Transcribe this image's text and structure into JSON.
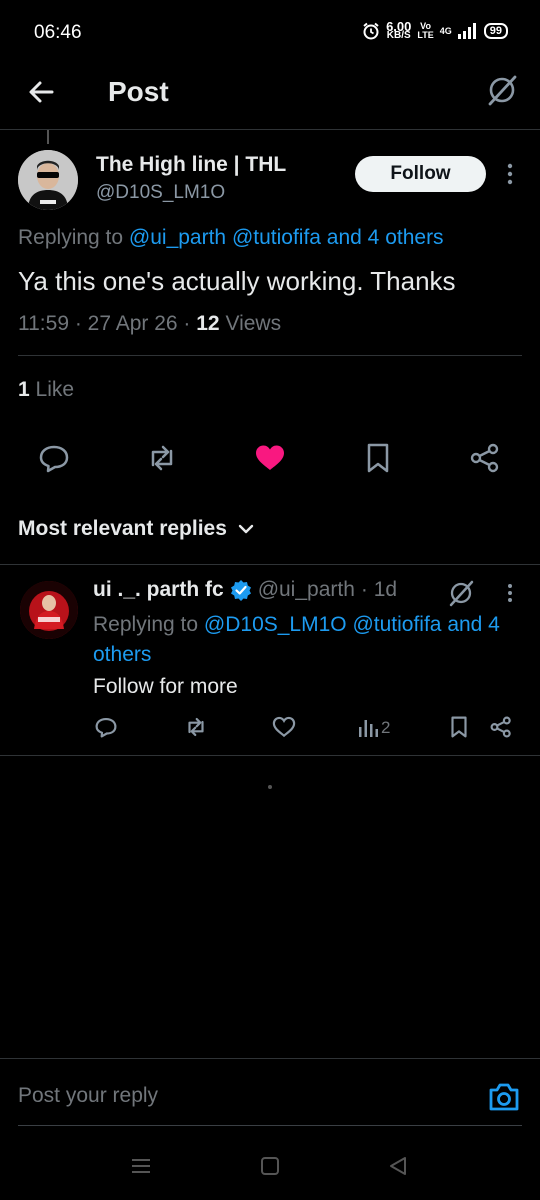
{
  "status_bar": {
    "time": "06:46",
    "speed_value": "6.00",
    "speed_unit": "KB/S",
    "volte_top": "Vo",
    "volte_bottom": "LTE",
    "network": "4G",
    "battery": "99"
  },
  "header": {
    "title": "Post",
    "back_icon": "arrow-left-icon",
    "grok_icon": "grok-icon"
  },
  "post": {
    "author_name": "The High line | THL",
    "author_handle": "@D10S_LM1O",
    "follow_label": "Follow",
    "replying_prefix": "Replying to ",
    "replying_links": "@ui_parth @tutiofifa and 4 others",
    "text": "Ya this one's actually working. Thanks",
    "time": "11:59",
    "date": "27 Apr 26",
    "views_count": "12",
    "views_label": "Views",
    "likes_count": "1",
    "likes_label": "Like",
    "liked_color": "#f91880"
  },
  "replies_sort": {
    "label": "Most relevant replies"
  },
  "reply": {
    "name": "ui ._. parth fc",
    "handle": "@ui_parth",
    "age": "· 1d",
    "replying_prefix": "Replying to ",
    "replying_links": "@D10S_LM1O @tutiofifa and 4 others",
    "text": "Follow for more",
    "views_count": "2",
    "verified_color": "#1d9bf0"
  },
  "composer": {
    "placeholder": "Post your reply",
    "camera_icon": "camera-icon"
  },
  "colors": {
    "accent": "#1d9bf0",
    "like": "#f91880",
    "muted": "#71767b"
  }
}
